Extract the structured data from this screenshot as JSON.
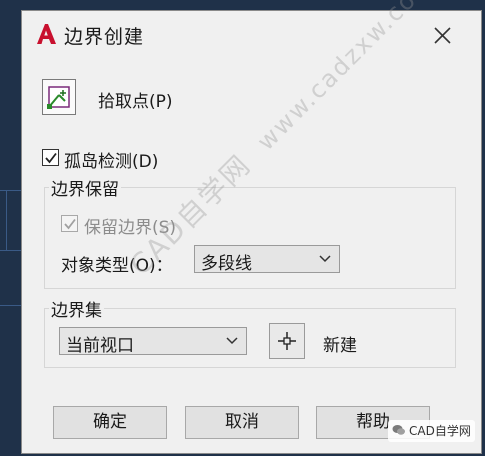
{
  "dialog": {
    "title": "边界创建",
    "pick_points_label": "拾取点(P)",
    "island_detection_label": "孤岛检测(D)",
    "island_detection_checked": true,
    "boundary_retention": {
      "group_title": "边界保留",
      "retain_boundaries_label": "保留边界(S)",
      "retain_boundaries_checked": true,
      "retain_boundaries_enabled": false,
      "object_type_label": "对象类型(O)：",
      "object_type_value": "多段线"
    },
    "boundary_set": {
      "group_title": "边界集",
      "selected_value": "当前视口",
      "new_label": "新建"
    },
    "buttons": {
      "ok": "确定",
      "cancel": "取消",
      "help": "帮助"
    }
  },
  "watermark": {
    "text": "CAD自学网",
    "url": "www.cadzxw.com",
    "badge": "CAD自学网"
  },
  "colors": {
    "dialog_bg": "#f0f0f0",
    "backdrop": "#1f3149",
    "app_icon_red": "#c8102e"
  }
}
